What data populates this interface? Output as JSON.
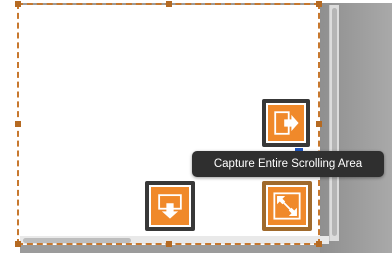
{
  "tooltip": {
    "text": "Capture Entire Scrolling Area"
  },
  "buttons": {
    "capture_visible_icon": "arrow-right-icon",
    "capture_entire_icon": "expand-diagonal-icon",
    "capture_below_icon": "arrow-down-icon"
  },
  "colors": {
    "accent_orange": "#f0892a",
    "selection_dashed": "#c7782e",
    "button_frame": "#383838",
    "active_frame": "#a06a2c",
    "tooltip_bg": "#2f2f2f"
  }
}
